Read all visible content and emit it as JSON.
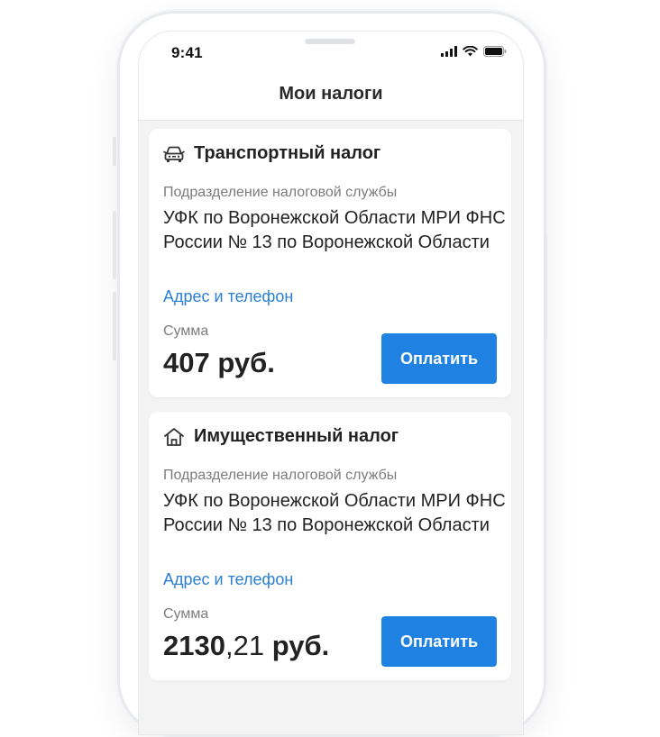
{
  "status_bar": {
    "time": "9:41"
  },
  "nav": {
    "title": "Мои налоги"
  },
  "cards": [
    {
      "icon": "car-icon",
      "title": "Транспортный налог",
      "dept_label": "Подразделение налоговой службы",
      "dept_name": "УФК по Воронежской Области МРИ ФНС России № 13 по Воронежской Области",
      "address_link": "Адрес и телефон",
      "sum_label": "Сумма",
      "sum_int": "407",
      "sum_frac": "",
      "sum_currency": " руб.",
      "pay_label": "Оплатить"
    },
    {
      "icon": "house-icon",
      "title": "Имущественный налог",
      "dept_label": "Подразделение налоговой службы",
      "dept_name": "УФК по Воронежской Области МРИ ФНС России № 13 по Воронежской Области",
      "address_link": "Адрес и телефон",
      "sum_label": "Сумма",
      "sum_int": "2130",
      "sum_frac": ",21",
      "sum_currency": " руб.",
      "pay_label": "Оплатить"
    }
  ],
  "colors": {
    "accent": "#1f82e3",
    "link": "#2a7fd4",
    "background": "#f3f3f4"
  }
}
